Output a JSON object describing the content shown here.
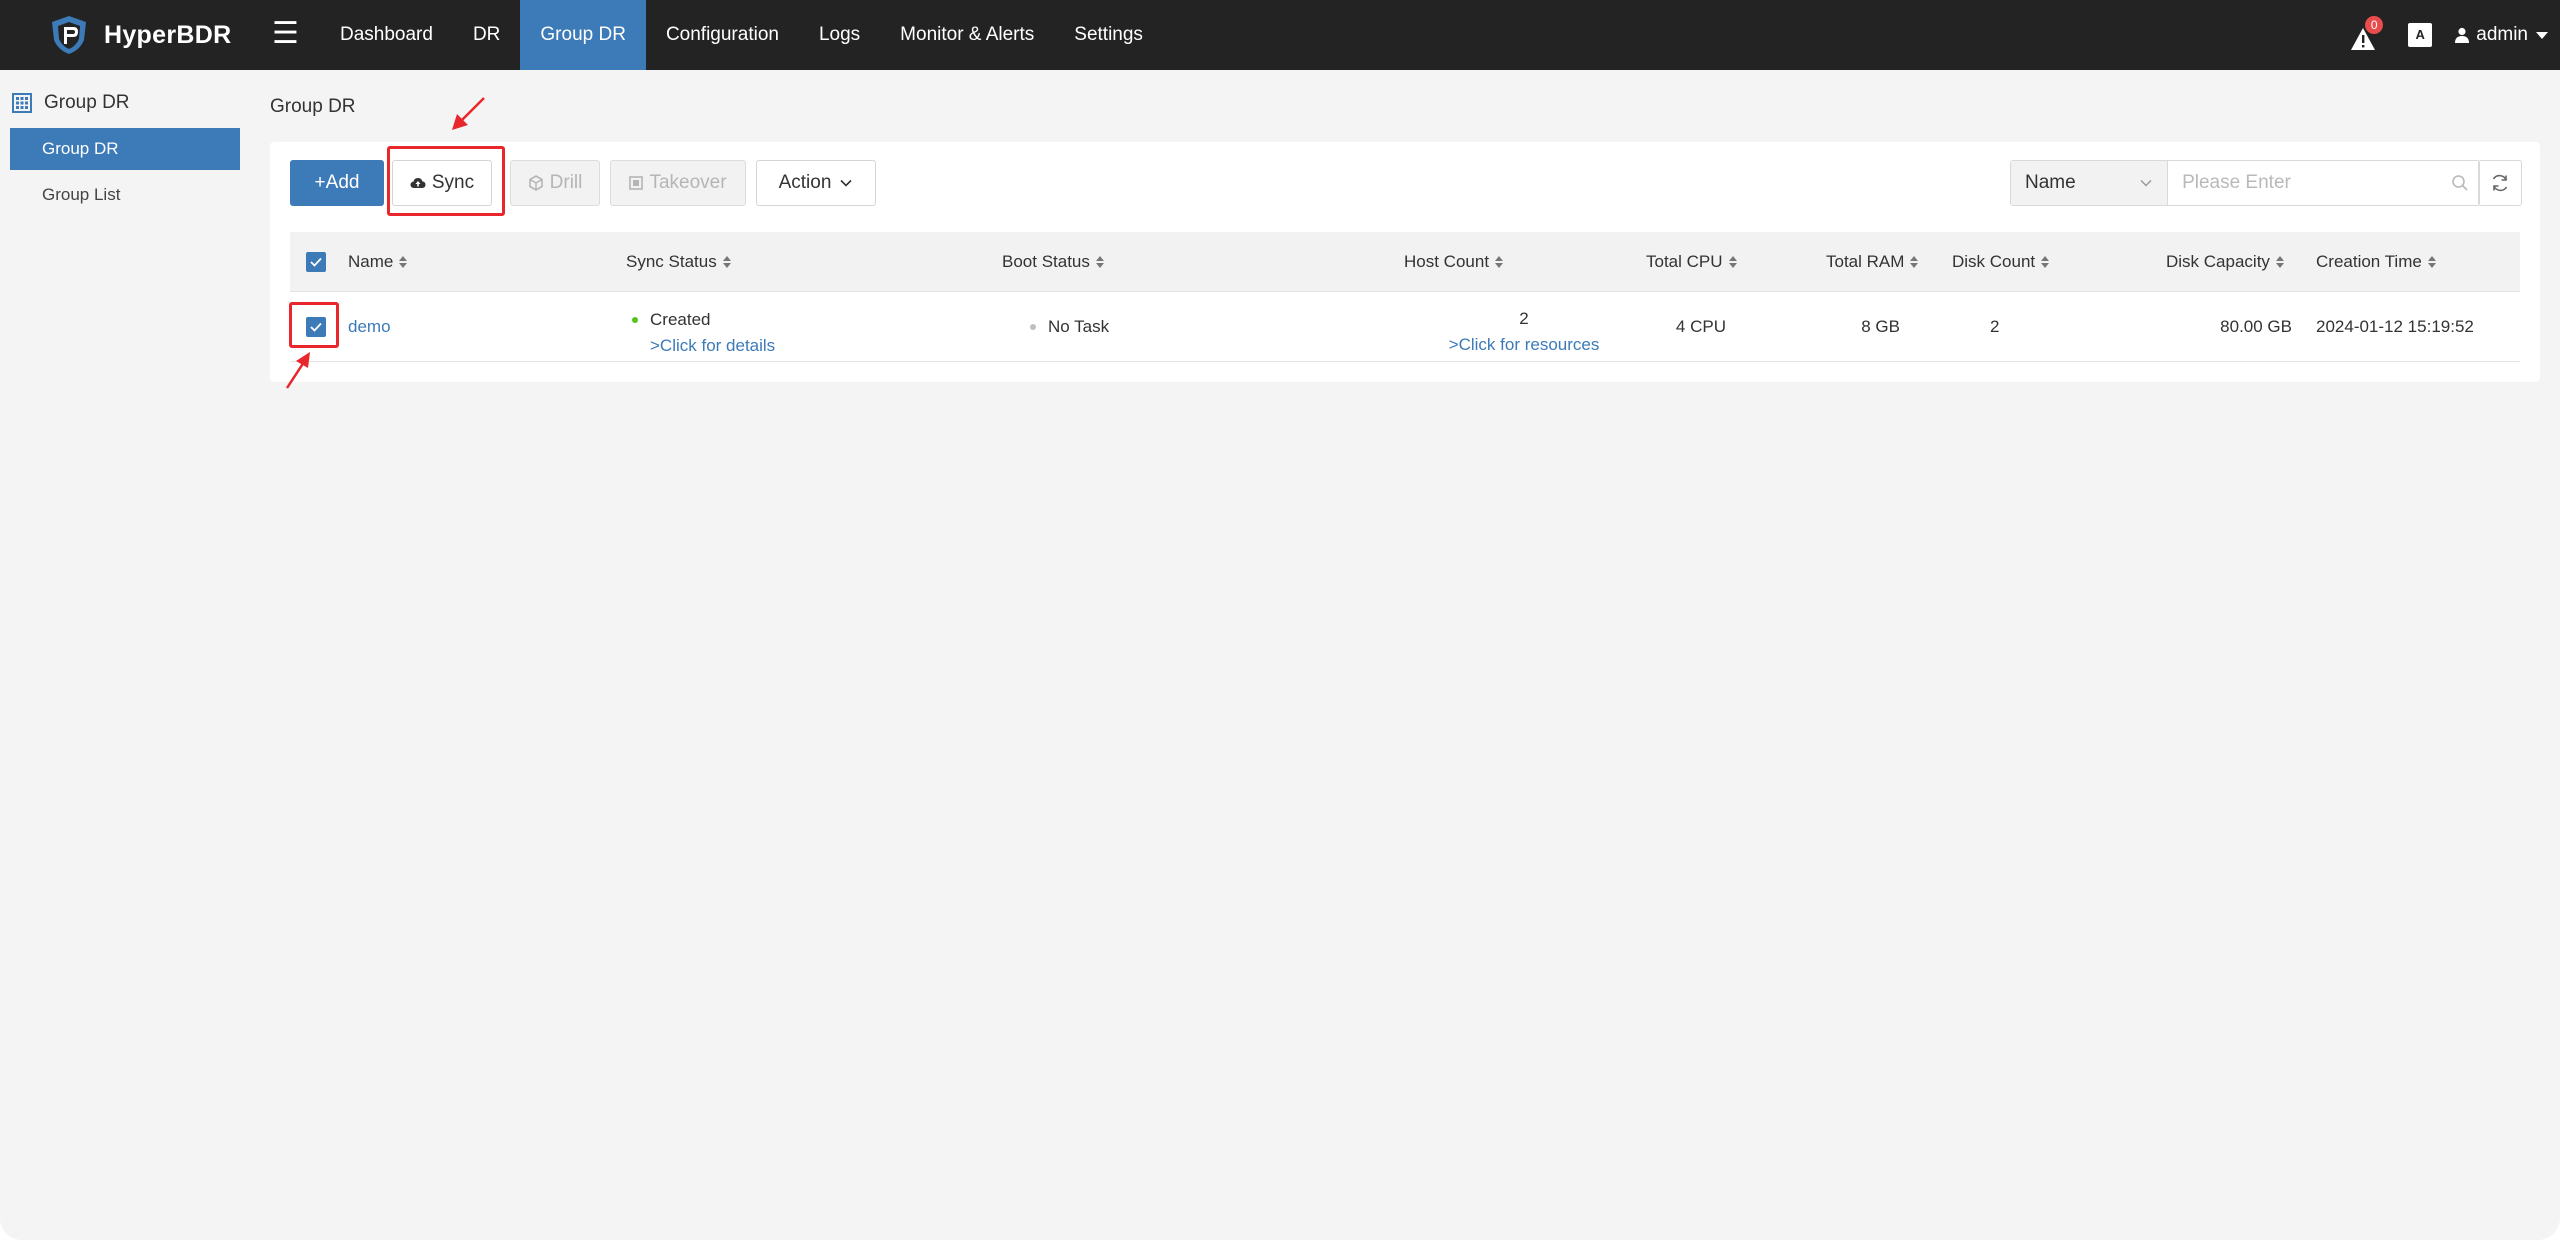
{
  "app": {
    "name": "HyperBDR"
  },
  "nav": {
    "items": [
      {
        "label": "Dashboard"
      },
      {
        "label": "DR"
      },
      {
        "label": "Group DR"
      },
      {
        "label": "Configuration"
      },
      {
        "label": "Logs"
      },
      {
        "label": "Monitor & Alerts"
      },
      {
        "label": "Settings"
      }
    ],
    "active_index": 2
  },
  "header": {
    "alert_count": "0",
    "lang_icon": "A",
    "user": "admin"
  },
  "sidebar": {
    "heading": "Group DR",
    "items": [
      {
        "label": "Group DR"
      },
      {
        "label": "Group List"
      }
    ]
  },
  "page": {
    "title": "Group DR"
  },
  "toolbar": {
    "add_label": "+Add",
    "sync_label": "Sync",
    "drill_label": "Drill",
    "takeover_label": "Takeover",
    "action_label": "Action"
  },
  "search": {
    "field": "Name",
    "placeholder": "Please Enter"
  },
  "table": {
    "columns": [
      "Name",
      "Sync Status",
      "Boot Status",
      "Host Count",
      "Total CPU",
      "Total RAM",
      "Disk Count",
      "Disk Capacity",
      "Creation Time"
    ],
    "rows": [
      {
        "name": "demo",
        "sync_status": "Created",
        "sync_link": ">Click for details",
        "boot_status": "No Task",
        "host_count": "2",
        "host_link": ">Click for resources",
        "total_cpu": "4 CPU",
        "total_ram": "8 GB",
        "disk_count": "2",
        "disk_capacity": "80.00 GB",
        "creation_time": "2024-01-12 15:19:52"
      }
    ]
  },
  "colors": {
    "topbar": "#232323",
    "accent": "#3c7ab8",
    "status_ok": "#52c41a",
    "status_idle": "#bfbfbf",
    "annotation": "#e8262b"
  }
}
